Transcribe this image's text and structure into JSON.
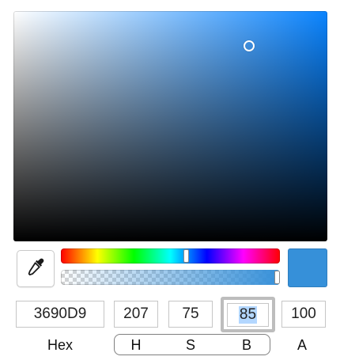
{
  "color_picker": {
    "saturation": 75,
    "brightness": 85,
    "hue": 207,
    "alpha": 100,
    "hue_position_fraction": 0.575,
    "alpha_position_fraction": 1.0,
    "swatch_color": "#3690D9",
    "field_hue_color": "#0A84FF"
  },
  "tools": {
    "eyedropper_icon": "eyedropper-icon"
  },
  "fields": {
    "hex_value": "3690D9",
    "h_value": "207",
    "s_value": "75",
    "b_value": "85",
    "a_value": "100"
  },
  "labels": {
    "hex": "Hex",
    "h": "H",
    "s": "S",
    "b": "B",
    "a": "A"
  }
}
